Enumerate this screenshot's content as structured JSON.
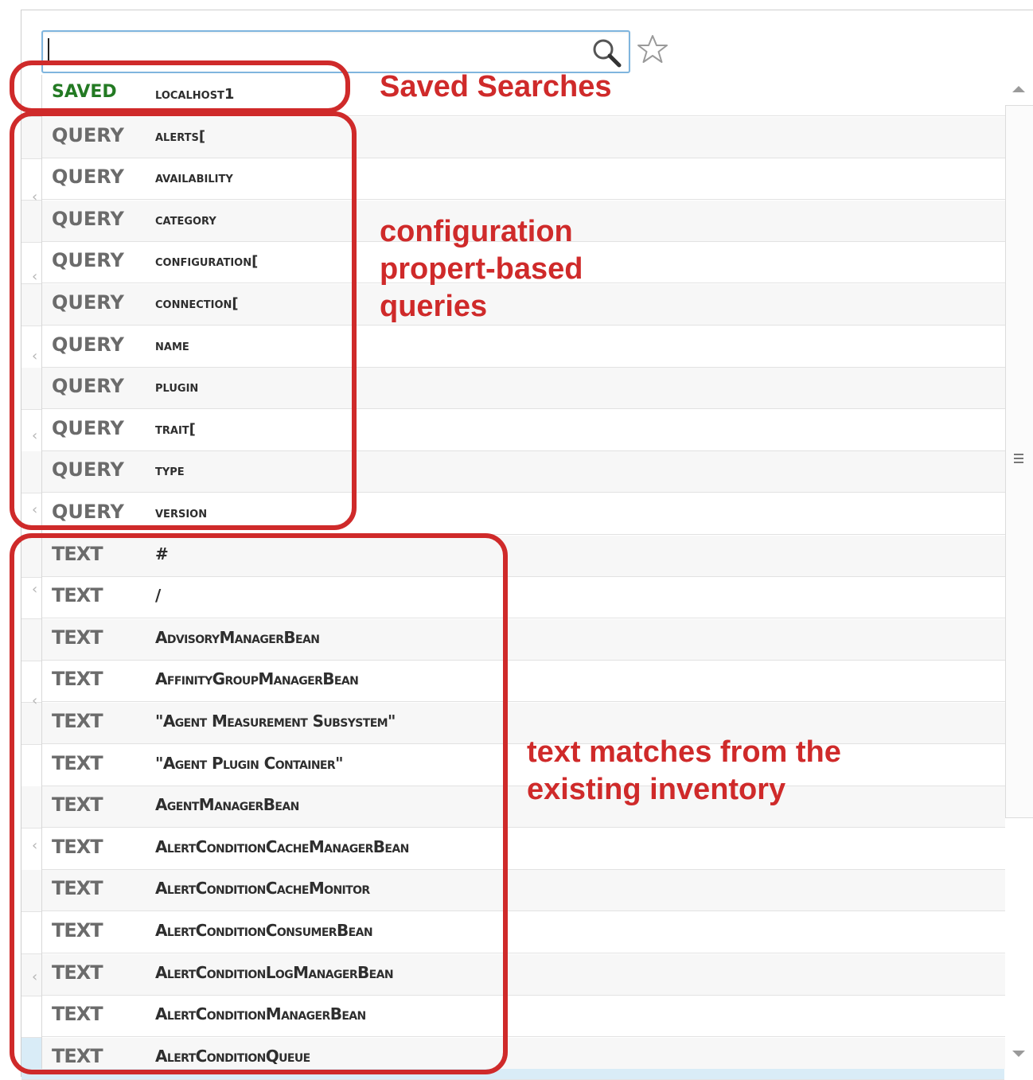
{
  "search": {
    "placeholder": ""
  },
  "icons": {
    "search": "search-icon",
    "favorite": "star-icon",
    "scrollbar_grip": "grip-icon",
    "drag_handle": "drag-handle-icon"
  },
  "colors": {
    "annotation": "#cf2a2a",
    "saved_type": "#237a23",
    "query_type": "#6b6b6b",
    "focus_border": "#7fb5de"
  },
  "suggestions": [
    {
      "type": "SAVED",
      "value": "localhost1"
    },
    {
      "type": "QUERY",
      "value": "alerts["
    },
    {
      "type": "QUERY",
      "value": "availability"
    },
    {
      "type": "QUERY",
      "value": "category"
    },
    {
      "type": "QUERY",
      "value": "configuration["
    },
    {
      "type": "QUERY",
      "value": "connection["
    },
    {
      "type": "QUERY",
      "value": "name"
    },
    {
      "type": "QUERY",
      "value": "plugin"
    },
    {
      "type": "QUERY",
      "value": "trait["
    },
    {
      "type": "QUERY",
      "value": "type"
    },
    {
      "type": "QUERY",
      "value": "version"
    },
    {
      "type": "TEXT",
      "value": "#"
    },
    {
      "type": "TEXT",
      "value": "/"
    },
    {
      "type": "TEXT",
      "value": "AdvisoryManagerBean"
    },
    {
      "type": "TEXT",
      "value": "AffinityGroupManagerBean"
    },
    {
      "type": "TEXT",
      "value": "\"Agent Measurement Subsystem\""
    },
    {
      "type": "TEXT",
      "value": "\"Agent Plugin Container\""
    },
    {
      "type": "TEXT",
      "value": "AgentManagerBean"
    },
    {
      "type": "TEXT",
      "value": "AlertConditionCacheManagerBean"
    },
    {
      "type": "TEXT",
      "value": "AlertConditionCacheMonitor"
    },
    {
      "type": "TEXT",
      "value": "AlertConditionConsumerBean"
    },
    {
      "type": "TEXT",
      "value": "AlertConditionLogManagerBean"
    },
    {
      "type": "TEXT",
      "value": "AlertConditionManagerBean"
    },
    {
      "type": "TEXT",
      "value": "AlertConditionQueue"
    }
  ],
  "annotations": {
    "saved": "Saved Searches",
    "query_lines": [
      "configuration",
      "propert-based",
      "queries"
    ],
    "text_lines": [
      "text matches from the",
      "existing inventory"
    ]
  }
}
